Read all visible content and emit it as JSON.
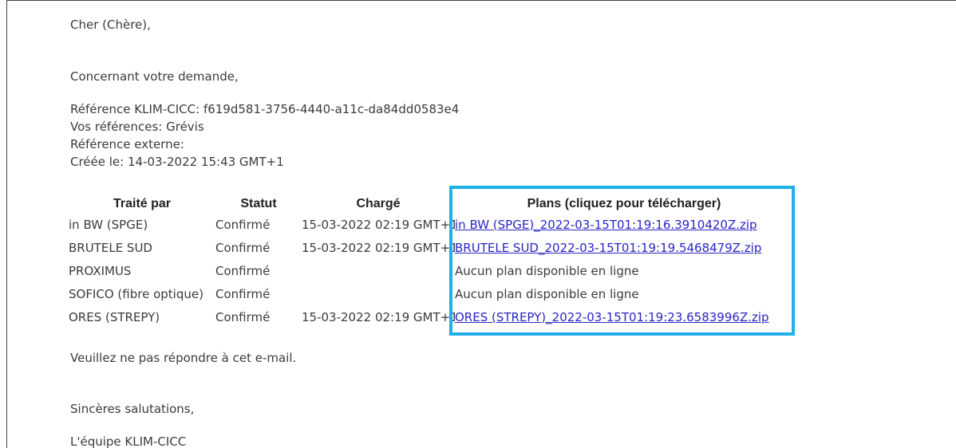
{
  "email": {
    "greeting": "Cher (Chère),",
    "intro": "Concernant votre demande,",
    "reference_klim": "Référence KLIM-CICC: f619d581-3756-4440-a11c-da84dd0583e4",
    "vos_references": "Vos références: Grévis",
    "reference_externe": "Référence externe:",
    "creee_le": "Créée le: 14-03-2022 15:43 GMT+1",
    "footer_notice": "Veuillez ne pas répondre à cet e-mail.",
    "closing": "Sincères salutations,",
    "signature": "L'équipe KLIM-CICC"
  },
  "table": {
    "headers": [
      "Traité par",
      "Statut",
      "Chargé",
      "Plans (cliquez pour télécharger)"
    ],
    "rows": [
      {
        "traite_par": "in BW (SPGE)",
        "statut": "Confirmé",
        "charge": "15-03-2022 02:19 GMT+1",
        "plan": "in BW (SPGE)_2022-03-15T01:19:16.3910420Z.zip",
        "plan_is_link": true
      },
      {
        "traite_par": "BRUTELE SUD",
        "statut": "Confirmé",
        "charge": "15-03-2022 02:19 GMT+1",
        "plan": "BRUTELE SUD_2022-03-15T01:19:19.5468479Z.zip",
        "plan_is_link": true
      },
      {
        "traite_par": "PROXIMUS",
        "statut": "Confirmé",
        "charge": "",
        "plan": "Aucun plan disponible en ligne",
        "plan_is_link": false
      },
      {
        "traite_par": "SOFICO (fibre optique)",
        "statut": "Confirmé",
        "charge": "",
        "plan": "Aucun plan disponible en ligne",
        "plan_is_link": false
      },
      {
        "traite_par": "ORES (STREPY)",
        "statut": "Confirmé",
        "charge": "15-03-2022 02:19 GMT+1",
        "plan": "ORES (STREPY)_2022-03-15T01:19:23.6583996Z.zip",
        "plan_is_link": true
      }
    ]
  },
  "colors": {
    "link": "#2a25c5",
    "highlight_border": "#1fb0e8",
    "text": "#3b3b3b"
  }
}
